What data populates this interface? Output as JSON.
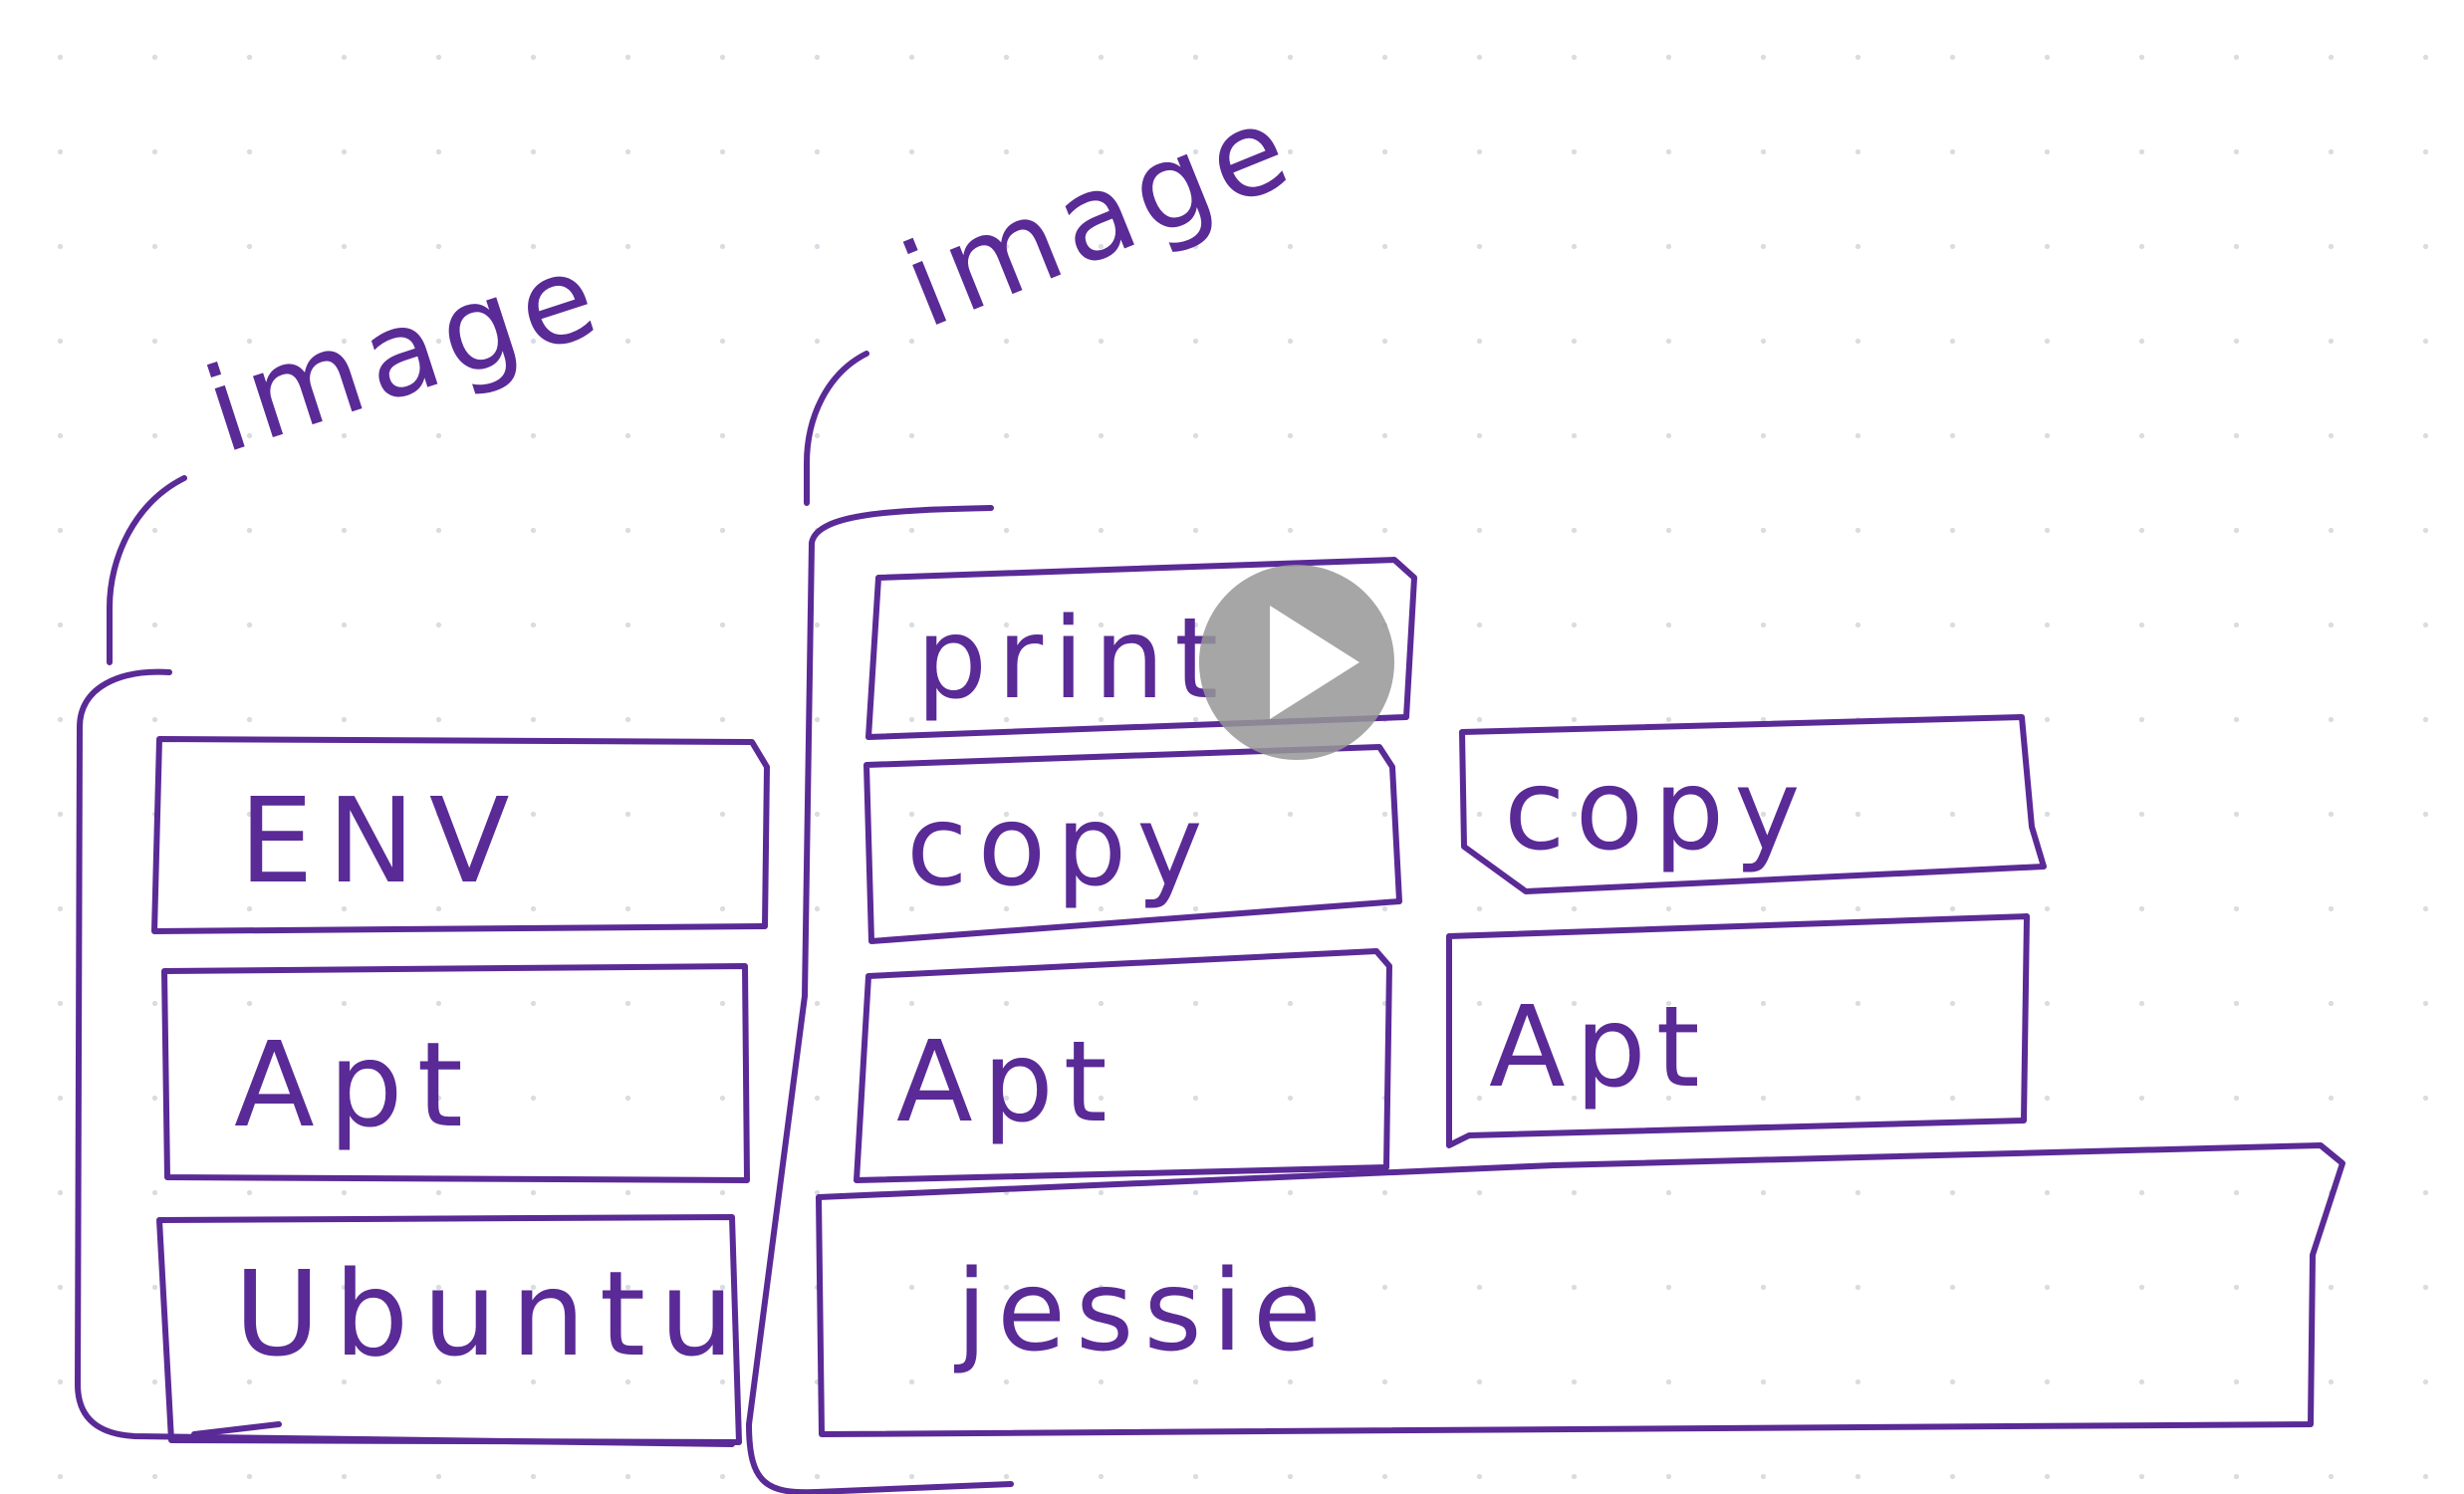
{
  "diagram": {
    "ink_color": "#5a2a96",
    "grid_dot_color": "#d9dce2",
    "titles": [
      {
        "id": "left-image",
        "text": "image"
      },
      {
        "id": "right-image",
        "text": "image"
      }
    ],
    "left_stack": {
      "layers": [
        "ENV",
        "Apt",
        "Ubuntu"
      ]
    },
    "middle_stack": {
      "layers": [
        "print",
        "copy",
        "Apt"
      ]
    },
    "right_stack": {
      "layers": [
        "copy",
        "Apt"
      ]
    },
    "base_layer": "jessie"
  },
  "video_overlay": {
    "icon": "play-icon"
  }
}
